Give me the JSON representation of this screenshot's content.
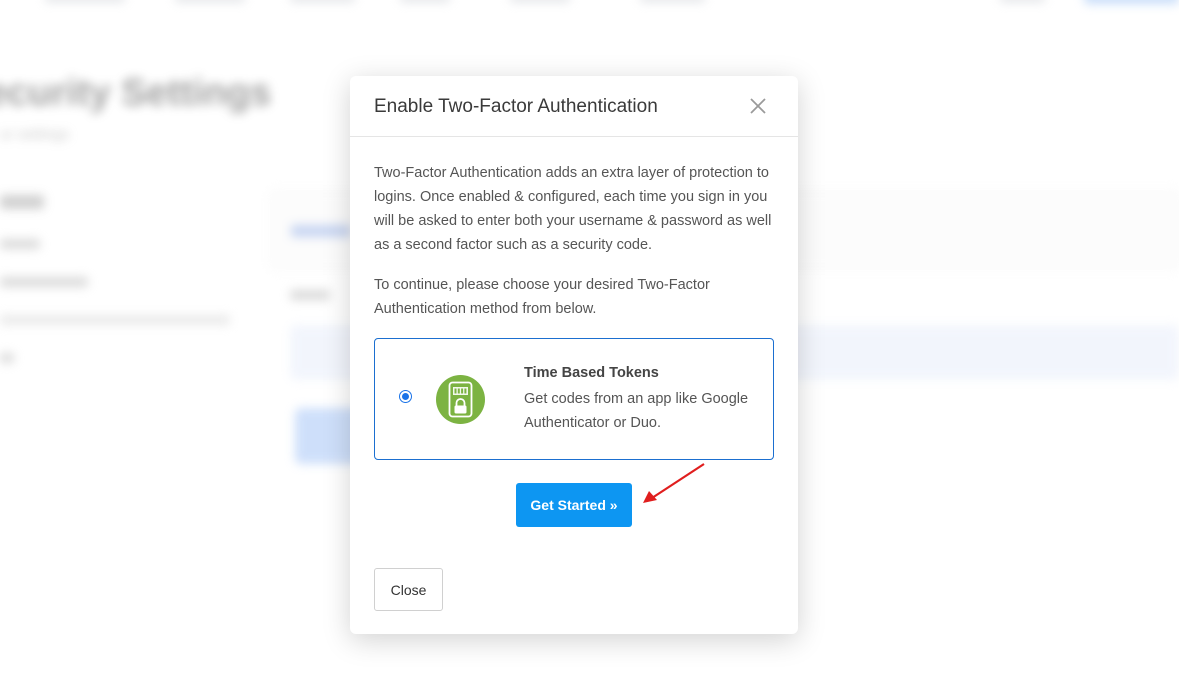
{
  "modal": {
    "title": "Enable Two-Factor Authentication",
    "intro": "Two-Factor Authentication adds an extra layer of protection to logins. Once enabled & configured, each time you sign in you will be asked to enter both your username & password as well as a second factor such as a security code.",
    "instruction": "To continue, please choose your desired Two-Factor Authentication method from below.",
    "method": {
      "title": "Time Based Tokens",
      "description": "Get codes from an app like Google Authenticator or Duo.",
      "icon": "phone-lock-icon",
      "icon_color": "#7cb342",
      "selected": true
    },
    "get_started_label": "Get Started »",
    "close_label": "Close"
  },
  "colors": {
    "accent": "#0d96f2",
    "card_border": "#1b6fd0",
    "annotation_arrow": "#e01e1e"
  }
}
